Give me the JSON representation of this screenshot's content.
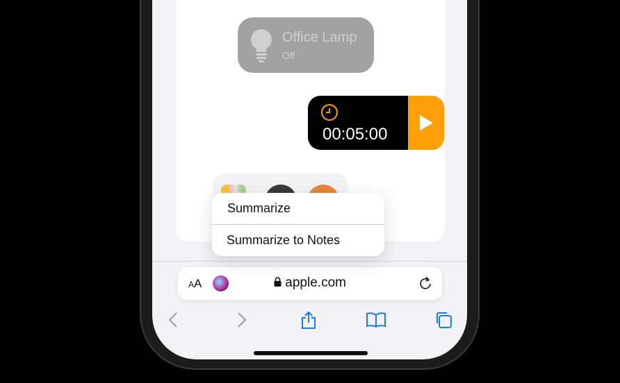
{
  "widgets": {
    "lamp": {
      "title": "Office Lamp",
      "status": "Off",
      "icon": "lightbulb-icon"
    },
    "timer": {
      "time": "00:05:00",
      "icon": "clock-icon",
      "accent": "#ff9f0a"
    }
  },
  "context_menu": {
    "items": [
      {
        "label": "Summarize"
      },
      {
        "label": "Summarize to Notes"
      }
    ]
  },
  "address_bar": {
    "text_size_label_small": "A",
    "text_size_label_large": "A",
    "domain": "apple.com",
    "secure": true
  },
  "toolbar": {
    "accent": "#1a7ae0",
    "items": [
      "back",
      "forward",
      "share",
      "bookmarks",
      "tabs"
    ]
  }
}
